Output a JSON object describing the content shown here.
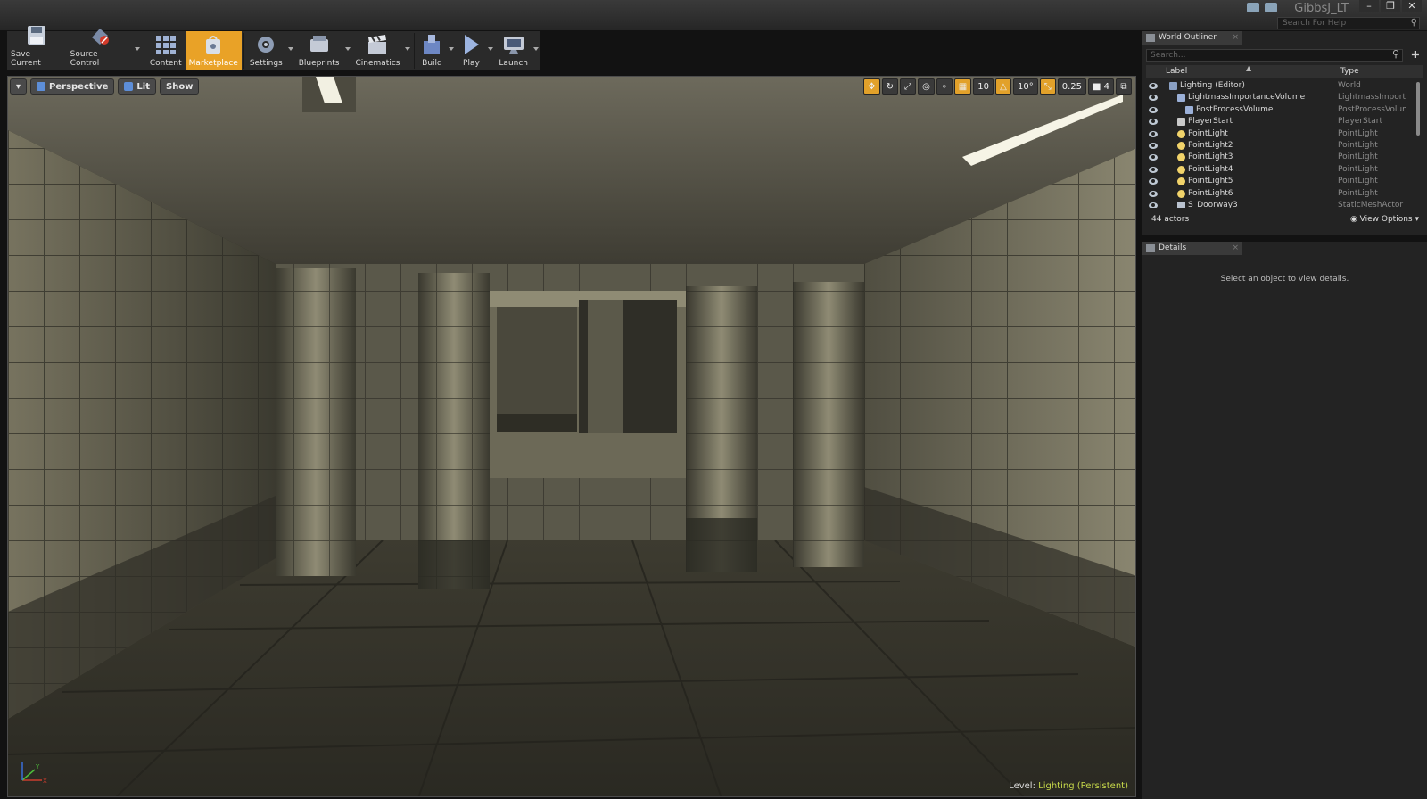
{
  "window": {
    "project_title": "GibbsJ_LT",
    "help_search_placeholder": "Search For Help",
    "controls": [
      "–",
      "❐",
      "✕"
    ]
  },
  "toolbar": {
    "buttons": [
      {
        "label": "Save Current",
        "icon": "save-icon"
      },
      {
        "label": "Source Control",
        "icon": "source-control-icon"
      },
      {
        "label": "Content",
        "icon": "content-icon"
      },
      {
        "label": "Marketplace",
        "icon": "marketplace-icon",
        "active": true
      },
      {
        "label": "Settings",
        "icon": "settings-icon"
      },
      {
        "label": "Blueprints",
        "icon": "blueprints-icon"
      },
      {
        "label": "Cinematics",
        "icon": "cinematics-icon"
      },
      {
        "label": "Build",
        "icon": "build-icon"
      },
      {
        "label": "Play",
        "icon": "play-icon"
      },
      {
        "label": "Launch",
        "icon": "launch-icon"
      }
    ],
    "accent_color": "#e9a227"
  },
  "viewport": {
    "view_mode_perspective": "Perspective",
    "view_mode_lit": "Lit",
    "show_label": "Show",
    "grid_snap": "10",
    "rotation_snap": "10°",
    "scale_snap": "0.25",
    "camera_speed": "4",
    "level_label": "Level:",
    "level_value": "Lighting (Persistent)",
    "axis_labels": {
      "x": "X",
      "y": "Y"
    }
  },
  "outliner": {
    "tab_title": "World Outliner",
    "search_placeholder": "Search...",
    "col_label": "Label",
    "col_type": "Type",
    "rows": [
      {
        "name": "Lighting (Editor)",
        "type": "World",
        "indent": 0
      },
      {
        "name": "LightmassImportanceVolume",
        "type": "LightmassImportanceVolume",
        "indent": 1
      },
      {
        "name": "PostProcessVolume",
        "type": "PostProcessVolume",
        "indent": 2
      },
      {
        "name": "PlayerStart",
        "type": "PlayerStart",
        "indent": 1
      },
      {
        "name": "PointLight",
        "type": "PointLight",
        "indent": 1
      },
      {
        "name": "PointLight2",
        "type": "PointLight",
        "indent": 1
      },
      {
        "name": "PointLight3",
        "type": "PointLight",
        "indent": 1
      },
      {
        "name": "PointLight4",
        "type": "PointLight",
        "indent": 1
      },
      {
        "name": "PointLight5",
        "type": "PointLight",
        "indent": 1
      },
      {
        "name": "PointLight6",
        "type": "PointLight",
        "indent": 1
      },
      {
        "name": "S_Doorway3",
        "type": "StaticMeshActor",
        "indent": 1
      }
    ],
    "actor_count": "44 actors",
    "view_options": "View Options"
  },
  "details": {
    "tab_title": "Details",
    "empty_message": "Select an object to view details."
  }
}
